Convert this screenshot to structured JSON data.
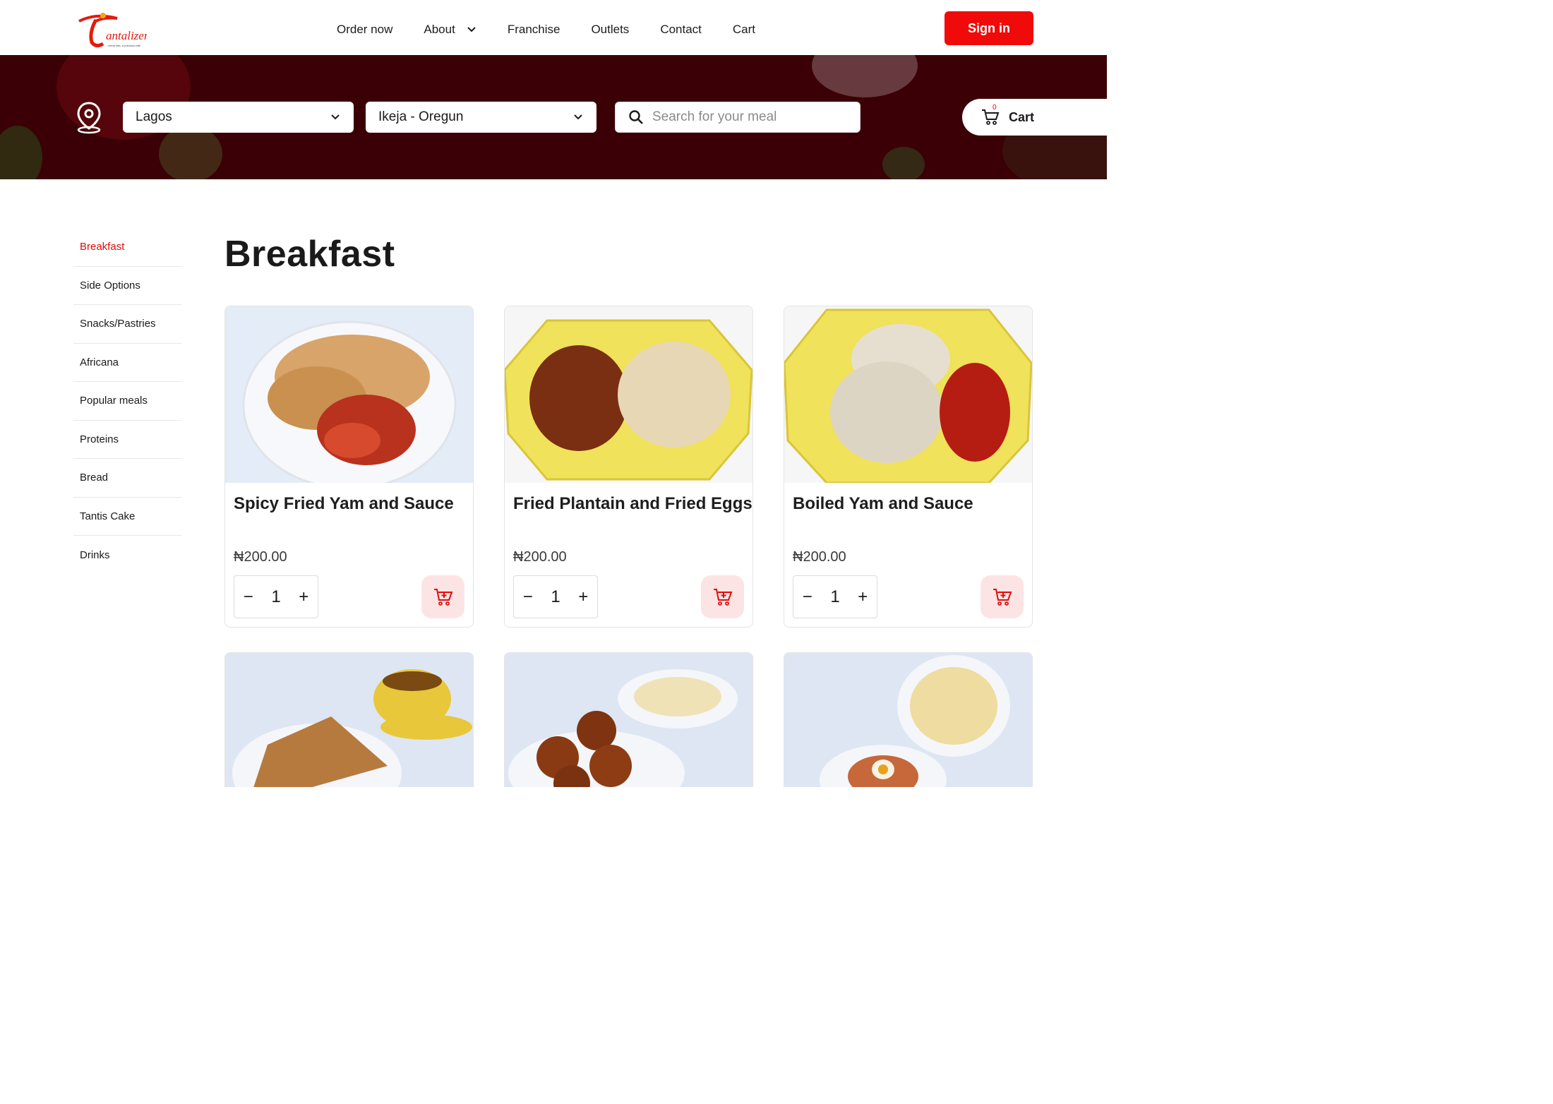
{
  "brand": {
    "logo_text": "Tantalizers",
    "tagline": "...every bite, a precious bite"
  },
  "nav": {
    "items": [
      {
        "label": "Order now",
        "has_dropdown": false
      },
      {
        "label": "About",
        "has_dropdown": true
      },
      {
        "label": "Franchise",
        "has_dropdown": false
      },
      {
        "label": "Outlets",
        "has_dropdown": false
      },
      {
        "label": "Contact",
        "has_dropdown": false
      },
      {
        "label": "Cart",
        "has_dropdown": false
      }
    ],
    "signin_label": "Sign in"
  },
  "location": {
    "state": "Lagos",
    "outlet": "Ikeja - Oregun"
  },
  "search": {
    "placeholder": "Search for your meal",
    "value": ""
  },
  "cart": {
    "label": "Cart",
    "count": "0"
  },
  "sidebar": {
    "items": [
      {
        "label": "Breakfast",
        "active": true
      },
      {
        "label": "Side Options",
        "active": false
      },
      {
        "label": "Snacks/Pastries",
        "active": false
      },
      {
        "label": "Africana",
        "active": false
      },
      {
        "label": "Popular meals",
        "active": false
      },
      {
        "label": "Proteins",
        "active": false
      },
      {
        "label": "Bread",
        "active": false
      },
      {
        "label": "Tantis Cake",
        "active": false
      },
      {
        "label": "Drinks",
        "active": false
      }
    ]
  },
  "main": {
    "title": "Breakfast",
    "products": [
      {
        "name": "Spicy Fried Yam and Sauce",
        "price": "₦200.00",
        "quantity": "1",
        "plate": "white"
      },
      {
        "name": "Fried Plantain and Fried Eggs",
        "price": "₦200.00",
        "quantity": "1",
        "plate": "yellow"
      },
      {
        "name": "Boiled Yam and Sauce",
        "price": "₦200.00",
        "quantity": "1",
        "plate": "yellow"
      },
      {
        "name": "",
        "price": "",
        "quantity": "",
        "plate": "white"
      },
      {
        "name": "",
        "price": "",
        "quantity": "",
        "plate": "white"
      },
      {
        "name": "",
        "price": "",
        "quantity": "",
        "plate": "white"
      }
    ],
    "stepper": {
      "minus": "−",
      "plus": "+"
    }
  },
  "colors": {
    "accent": "#f00a0a",
    "active_link": "#e30a0a",
    "hero_bg": "#3a0005",
    "add_cart_bg": "#fde4e4"
  }
}
